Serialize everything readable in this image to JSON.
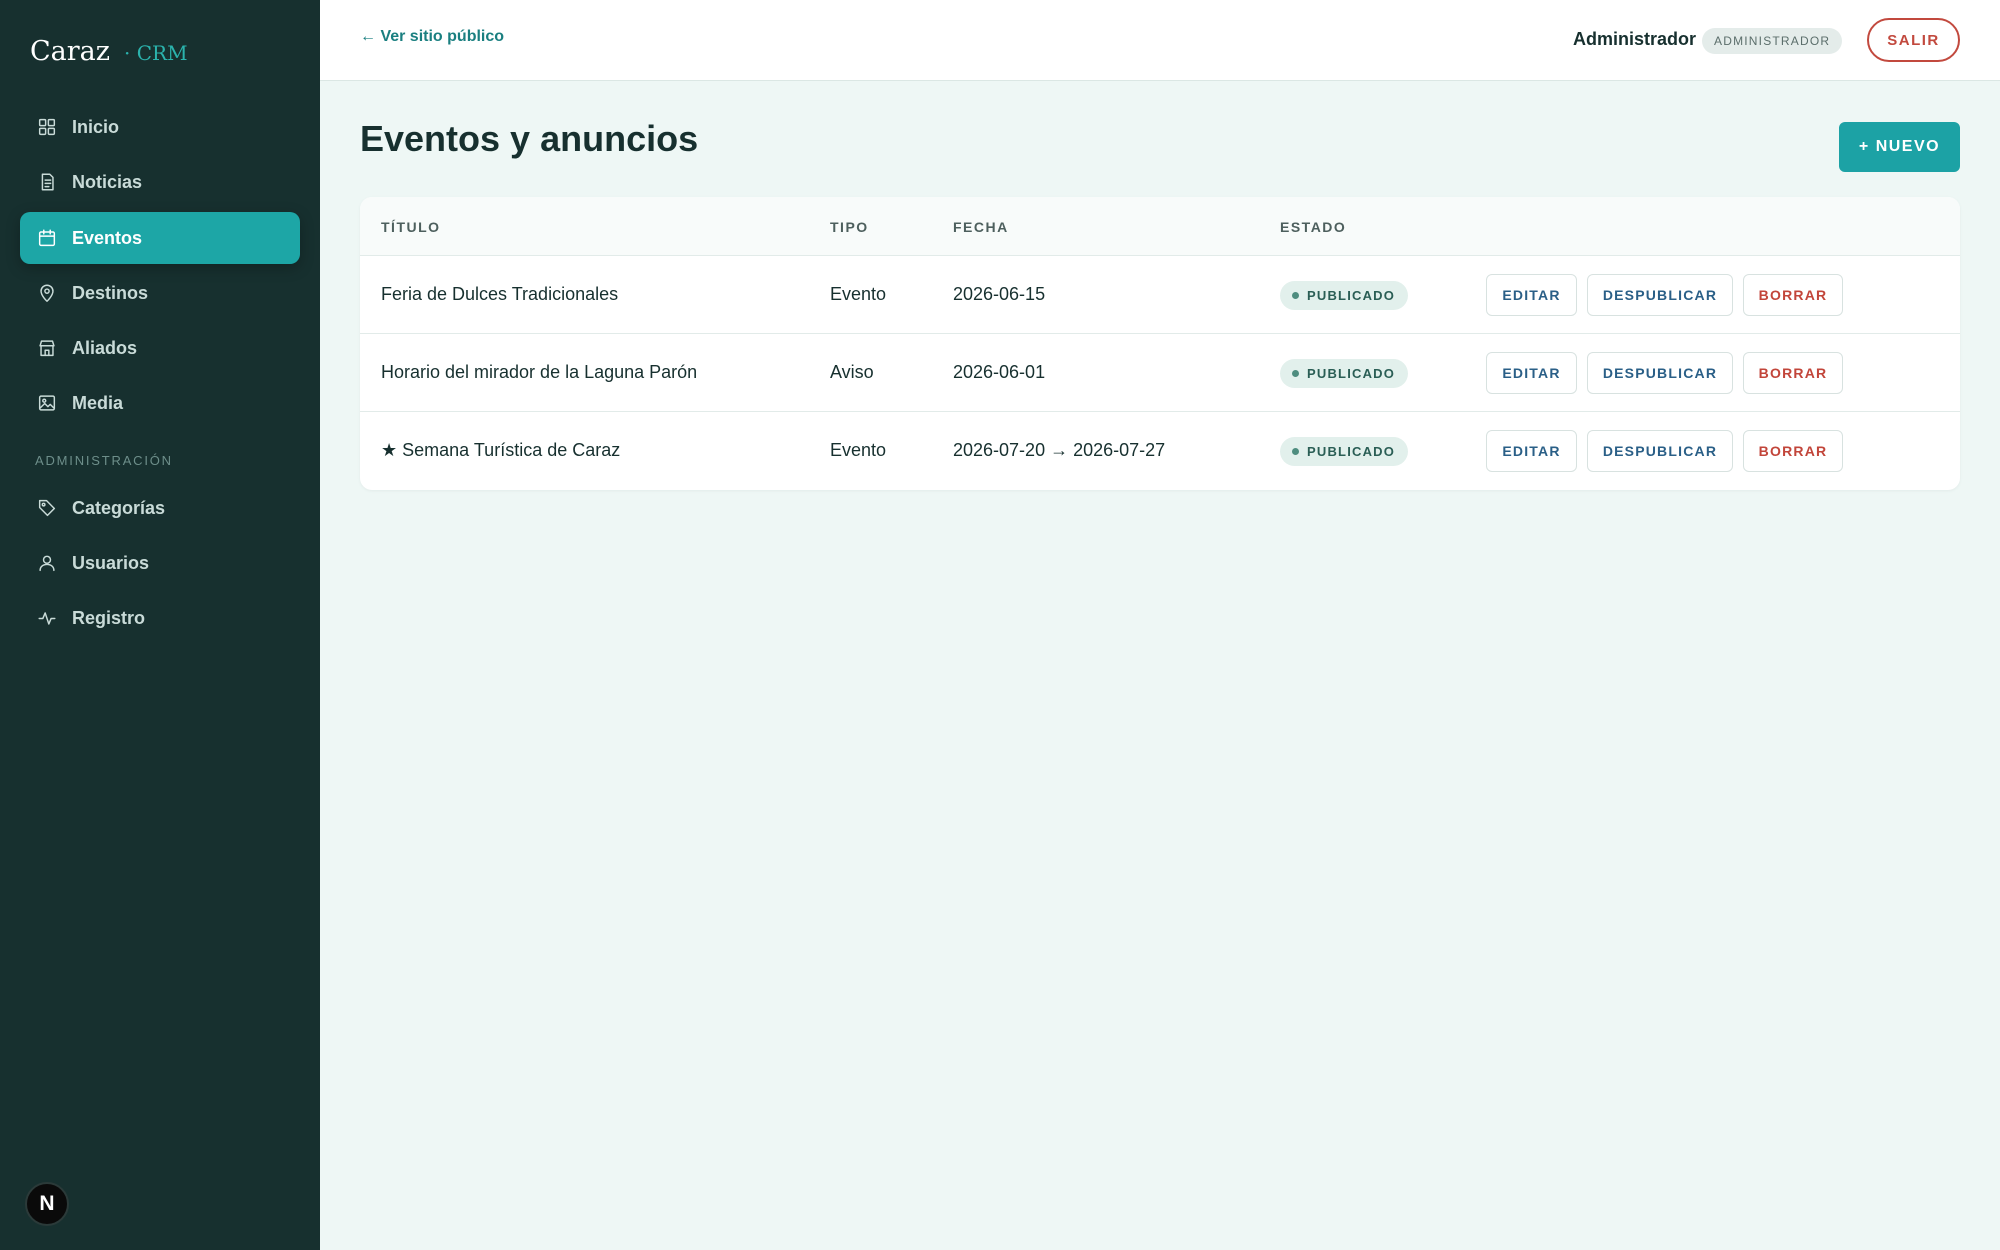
{
  "sidebar": {
    "brand": "Caraz",
    "brand_sub": "· CRM",
    "items": [
      {
        "label": "Inicio",
        "icon": "grid-icon",
        "active": false
      },
      {
        "label": "Noticias",
        "icon": "document-icon",
        "active": false
      },
      {
        "label": "Eventos",
        "icon": "calendar-icon",
        "active": true
      },
      {
        "label": "Destinos",
        "icon": "map-pin-icon",
        "active": false
      },
      {
        "label": "Aliados",
        "icon": "store-icon",
        "active": false
      },
      {
        "label": "Media",
        "icon": "image-icon",
        "active": false
      }
    ],
    "admin_section_label": "ADMINISTRACIÓN",
    "admin_items": [
      {
        "label": "Categorías",
        "icon": "tag-icon"
      },
      {
        "label": "Usuarios",
        "icon": "user-icon"
      },
      {
        "label": "Registro",
        "icon": "activity-icon"
      }
    ],
    "footer_badge": "N"
  },
  "header": {
    "back_link": "← Ver sitio público",
    "user_name": "Administrador",
    "role_badge": "ADMINISTRADOR",
    "logout_label": "SALIR"
  },
  "main": {
    "title": "Eventos y anuncios",
    "new_button": "+ NUEVO",
    "table": {
      "columns": [
        "TÍTULO",
        "TIPO",
        "FECHA",
        "ESTADO"
      ],
      "rows": [
        {
          "title": "Feria de Dulces Tradicionales",
          "type": "Evento",
          "date": "2026-06-15",
          "status": "PUBLICADO"
        },
        {
          "title": "Horario del mirador de la Laguna Parón",
          "type": "Aviso",
          "date": "2026-06-01",
          "status": "PUBLICADO"
        },
        {
          "title": "★ Semana Turística de Caraz",
          "type": "Evento",
          "date": "2026-07-20 → 2026-07-27",
          "status": "PUBLICADO"
        }
      ],
      "actions": {
        "edit": "EDITAR",
        "unpublish": "DESPUBLICAR",
        "delete": "BORRAR"
      }
    }
  },
  "colors": {
    "sidebar_bg": "#17302f",
    "accent": "#1da6a6",
    "danger": "#c2493e",
    "page_bg": "#eef7f5"
  }
}
